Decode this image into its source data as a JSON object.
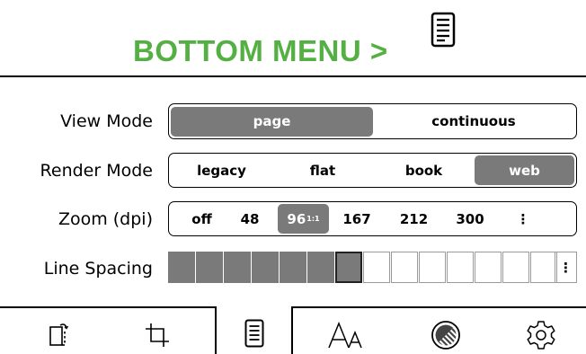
{
  "header": {
    "title": "BOTTOM MENU >",
    "title_color": "#55b043",
    "icon": "document-icon"
  },
  "settings": {
    "view_mode": {
      "label": "View Mode",
      "options": [
        "page",
        "continuous"
      ],
      "selected": "page"
    },
    "render_mode": {
      "label": "Render Mode",
      "options": [
        "legacy",
        "flat",
        "book",
        "web"
      ],
      "selected": "web"
    },
    "zoom": {
      "label": "Zoom (dpi)",
      "options": [
        "off",
        "48",
        "96",
        "167",
        "212",
        "300"
      ],
      "selected": "96",
      "selected_sup": "1:1",
      "more": "⋮"
    },
    "line_spacing": {
      "label": "Line Spacing",
      "steps_total": 14,
      "selected_step": 7,
      "more": "⋮"
    }
  },
  "bottom_bar": {
    "icons": [
      "rotate-screen-icon",
      "crop-icon",
      "document-icon",
      "font-size-icon",
      "contrast-icon",
      "settings-gear-icon"
    ],
    "active": "document-icon"
  },
  "colors": {
    "selected_fill": "#7a7a7a",
    "accent_green": "#55b043"
  }
}
